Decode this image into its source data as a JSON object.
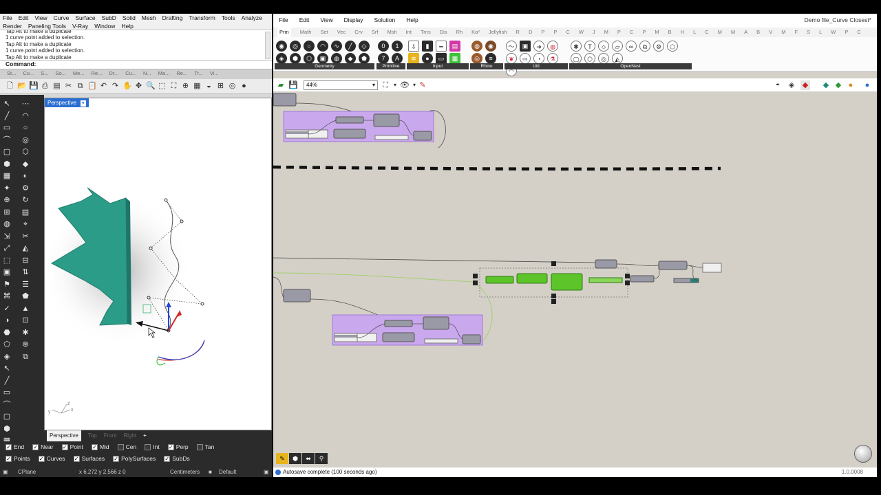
{
  "rhino": {
    "menu_row1": [
      "File",
      "Edit",
      "View",
      "Curve",
      "Surface",
      "SubD",
      "Solid",
      "Mesh",
      "Drafting",
      "Transform",
      "Tools",
      "Analyze"
    ],
    "menu_row2": [
      "Render",
      "Paneling Tools",
      "V-Ray",
      "Window",
      "Help"
    ],
    "command_history": [
      "Tap Alt to make a duplicate",
      "1 curve point added to selection.",
      "Tap Alt to make a duplicate",
      "1 curve point added to selection.",
      "Tap Alt to make a duplicate"
    ],
    "command_label": "Command:",
    "command_value": "",
    "toolbar_tabs": [
      "St...",
      "Cu...",
      "S...",
      "So...",
      "Me...",
      "Re...",
      "Dr...",
      "Cu...",
      "N...",
      "Ma...",
      "Re...",
      "Tr...",
      "Vi..."
    ],
    "viewport_title": "Perspective",
    "viewport_tabs": [
      "Perspective",
      "Top",
      "Front",
      "Right"
    ],
    "viewport_add": "+",
    "osnap_row1": [
      {
        "label": "End",
        "checked": true
      },
      {
        "label": "Near",
        "checked": true
      },
      {
        "label": "Point",
        "checked": true
      },
      {
        "label": "Mid",
        "checked": true
      },
      {
        "label": "Cen",
        "checked": false
      },
      {
        "label": "Int",
        "checked": false
      },
      {
        "label": "Perp",
        "checked": true
      },
      {
        "label": "Tan",
        "checked": false
      }
    ],
    "osnap_row2": [
      {
        "label": "Points",
        "checked": true
      },
      {
        "label": "Curves",
        "checked": true
      },
      {
        "label": "Surfaces",
        "checked": true
      },
      {
        "label": "PolySurfaces",
        "checked": true
      },
      {
        "label": "SubDs",
        "checked": true
      }
    ],
    "status": {
      "cplane": "CPlane",
      "coords": "x 6.272  y 2.566  z 0",
      "units": "Centimeters",
      "layer": "Default"
    },
    "axis_labels": {
      "x": "x",
      "y": "y",
      "z": "z"
    }
  },
  "gh": {
    "menu": [
      "File",
      "Edit",
      "View",
      "Display",
      "Solution",
      "Help"
    ],
    "title": "Demo file_Curve Closest*",
    "tabs": [
      "Prm",
      "Math",
      "Set",
      "Vec",
      "Crv",
      "Srf",
      "Msh",
      "Int",
      "Trns",
      "Dis",
      "Rh",
      "Ka²",
      "Jellyfish",
      "R",
      "D",
      "P",
      "P",
      "C",
      "W",
      "J",
      "M",
      "P",
      "C",
      "P",
      "M",
      "B",
      "H",
      "L",
      "C",
      "M",
      "M",
      "A",
      "B",
      "V",
      "M",
      "F",
      "S",
      "L",
      "W",
      "P",
      "C"
    ],
    "groups": [
      {
        "label": "Geometry"
      },
      {
        "label": "Primitive"
      },
      {
        "label": "Input"
      },
      {
        "label": "Rhino"
      },
      {
        "label": "Util"
      },
      {
        "label": "OpenNest"
      }
    ],
    "zoom": "44%",
    "status_message": "Autosave complete (100 seconds ago)",
    "version": "1.0.0008"
  },
  "colors": {
    "group_fill": "#c9a8ee",
    "component": "#9a99a6",
    "selected_component": "#5dc42a",
    "canvas": "#d4d0c8",
    "wire": "#4a4a4a",
    "green_wire": "#a5cf6e"
  }
}
